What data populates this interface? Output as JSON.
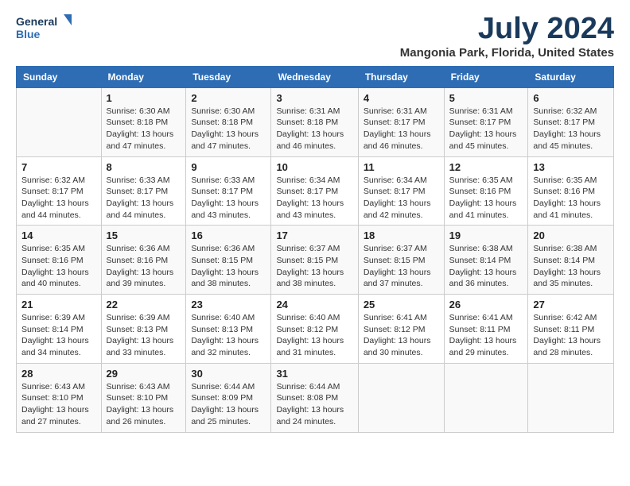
{
  "header": {
    "logo_line1": "General",
    "logo_line2": "Blue",
    "title": "July 2024",
    "subtitle": "Mangonia Park, Florida, United States"
  },
  "weekdays": [
    "Sunday",
    "Monday",
    "Tuesday",
    "Wednesday",
    "Thursday",
    "Friday",
    "Saturday"
  ],
  "weeks": [
    [
      {
        "day": "",
        "sunrise": "",
        "sunset": "",
        "daylight": ""
      },
      {
        "day": "1",
        "sunrise": "Sunrise: 6:30 AM",
        "sunset": "Sunset: 8:18 PM",
        "daylight": "Daylight: 13 hours and 47 minutes."
      },
      {
        "day": "2",
        "sunrise": "Sunrise: 6:30 AM",
        "sunset": "Sunset: 8:18 PM",
        "daylight": "Daylight: 13 hours and 47 minutes."
      },
      {
        "day": "3",
        "sunrise": "Sunrise: 6:31 AM",
        "sunset": "Sunset: 8:18 PM",
        "daylight": "Daylight: 13 hours and 46 minutes."
      },
      {
        "day": "4",
        "sunrise": "Sunrise: 6:31 AM",
        "sunset": "Sunset: 8:17 PM",
        "daylight": "Daylight: 13 hours and 46 minutes."
      },
      {
        "day": "5",
        "sunrise": "Sunrise: 6:31 AM",
        "sunset": "Sunset: 8:17 PM",
        "daylight": "Daylight: 13 hours and 45 minutes."
      },
      {
        "day": "6",
        "sunrise": "Sunrise: 6:32 AM",
        "sunset": "Sunset: 8:17 PM",
        "daylight": "Daylight: 13 hours and 45 minutes."
      }
    ],
    [
      {
        "day": "7",
        "sunrise": "Sunrise: 6:32 AM",
        "sunset": "Sunset: 8:17 PM",
        "daylight": "Daylight: 13 hours and 44 minutes."
      },
      {
        "day": "8",
        "sunrise": "Sunrise: 6:33 AM",
        "sunset": "Sunset: 8:17 PM",
        "daylight": "Daylight: 13 hours and 44 minutes."
      },
      {
        "day": "9",
        "sunrise": "Sunrise: 6:33 AM",
        "sunset": "Sunset: 8:17 PM",
        "daylight": "Daylight: 13 hours and 43 minutes."
      },
      {
        "day": "10",
        "sunrise": "Sunrise: 6:34 AM",
        "sunset": "Sunset: 8:17 PM",
        "daylight": "Daylight: 13 hours and 43 minutes."
      },
      {
        "day": "11",
        "sunrise": "Sunrise: 6:34 AM",
        "sunset": "Sunset: 8:17 PM",
        "daylight": "Daylight: 13 hours and 42 minutes."
      },
      {
        "day": "12",
        "sunrise": "Sunrise: 6:35 AM",
        "sunset": "Sunset: 8:16 PM",
        "daylight": "Daylight: 13 hours and 41 minutes."
      },
      {
        "day": "13",
        "sunrise": "Sunrise: 6:35 AM",
        "sunset": "Sunset: 8:16 PM",
        "daylight": "Daylight: 13 hours and 41 minutes."
      }
    ],
    [
      {
        "day": "14",
        "sunrise": "Sunrise: 6:35 AM",
        "sunset": "Sunset: 8:16 PM",
        "daylight": "Daylight: 13 hours and 40 minutes."
      },
      {
        "day": "15",
        "sunrise": "Sunrise: 6:36 AM",
        "sunset": "Sunset: 8:16 PM",
        "daylight": "Daylight: 13 hours and 39 minutes."
      },
      {
        "day": "16",
        "sunrise": "Sunrise: 6:36 AM",
        "sunset": "Sunset: 8:15 PM",
        "daylight": "Daylight: 13 hours and 38 minutes."
      },
      {
        "day": "17",
        "sunrise": "Sunrise: 6:37 AM",
        "sunset": "Sunset: 8:15 PM",
        "daylight": "Daylight: 13 hours and 38 minutes."
      },
      {
        "day": "18",
        "sunrise": "Sunrise: 6:37 AM",
        "sunset": "Sunset: 8:15 PM",
        "daylight": "Daylight: 13 hours and 37 minutes."
      },
      {
        "day": "19",
        "sunrise": "Sunrise: 6:38 AM",
        "sunset": "Sunset: 8:14 PM",
        "daylight": "Daylight: 13 hours and 36 minutes."
      },
      {
        "day": "20",
        "sunrise": "Sunrise: 6:38 AM",
        "sunset": "Sunset: 8:14 PM",
        "daylight": "Daylight: 13 hours and 35 minutes."
      }
    ],
    [
      {
        "day": "21",
        "sunrise": "Sunrise: 6:39 AM",
        "sunset": "Sunset: 8:14 PM",
        "daylight": "Daylight: 13 hours and 34 minutes."
      },
      {
        "day": "22",
        "sunrise": "Sunrise: 6:39 AM",
        "sunset": "Sunset: 8:13 PM",
        "daylight": "Daylight: 13 hours and 33 minutes."
      },
      {
        "day": "23",
        "sunrise": "Sunrise: 6:40 AM",
        "sunset": "Sunset: 8:13 PM",
        "daylight": "Daylight: 13 hours and 32 minutes."
      },
      {
        "day": "24",
        "sunrise": "Sunrise: 6:40 AM",
        "sunset": "Sunset: 8:12 PM",
        "daylight": "Daylight: 13 hours and 31 minutes."
      },
      {
        "day": "25",
        "sunrise": "Sunrise: 6:41 AM",
        "sunset": "Sunset: 8:12 PM",
        "daylight": "Daylight: 13 hours and 30 minutes."
      },
      {
        "day": "26",
        "sunrise": "Sunrise: 6:41 AM",
        "sunset": "Sunset: 8:11 PM",
        "daylight": "Daylight: 13 hours and 29 minutes."
      },
      {
        "day": "27",
        "sunrise": "Sunrise: 6:42 AM",
        "sunset": "Sunset: 8:11 PM",
        "daylight": "Daylight: 13 hours and 28 minutes."
      }
    ],
    [
      {
        "day": "28",
        "sunrise": "Sunrise: 6:43 AM",
        "sunset": "Sunset: 8:10 PM",
        "daylight": "Daylight: 13 hours and 27 minutes."
      },
      {
        "day": "29",
        "sunrise": "Sunrise: 6:43 AM",
        "sunset": "Sunset: 8:10 PM",
        "daylight": "Daylight: 13 hours and 26 minutes."
      },
      {
        "day": "30",
        "sunrise": "Sunrise: 6:44 AM",
        "sunset": "Sunset: 8:09 PM",
        "daylight": "Daylight: 13 hours and 25 minutes."
      },
      {
        "day": "31",
        "sunrise": "Sunrise: 6:44 AM",
        "sunset": "Sunset: 8:08 PM",
        "daylight": "Daylight: 13 hours and 24 minutes."
      },
      {
        "day": "",
        "sunrise": "",
        "sunset": "",
        "daylight": ""
      },
      {
        "day": "",
        "sunrise": "",
        "sunset": "",
        "daylight": ""
      },
      {
        "day": "",
        "sunrise": "",
        "sunset": "",
        "daylight": ""
      }
    ]
  ]
}
